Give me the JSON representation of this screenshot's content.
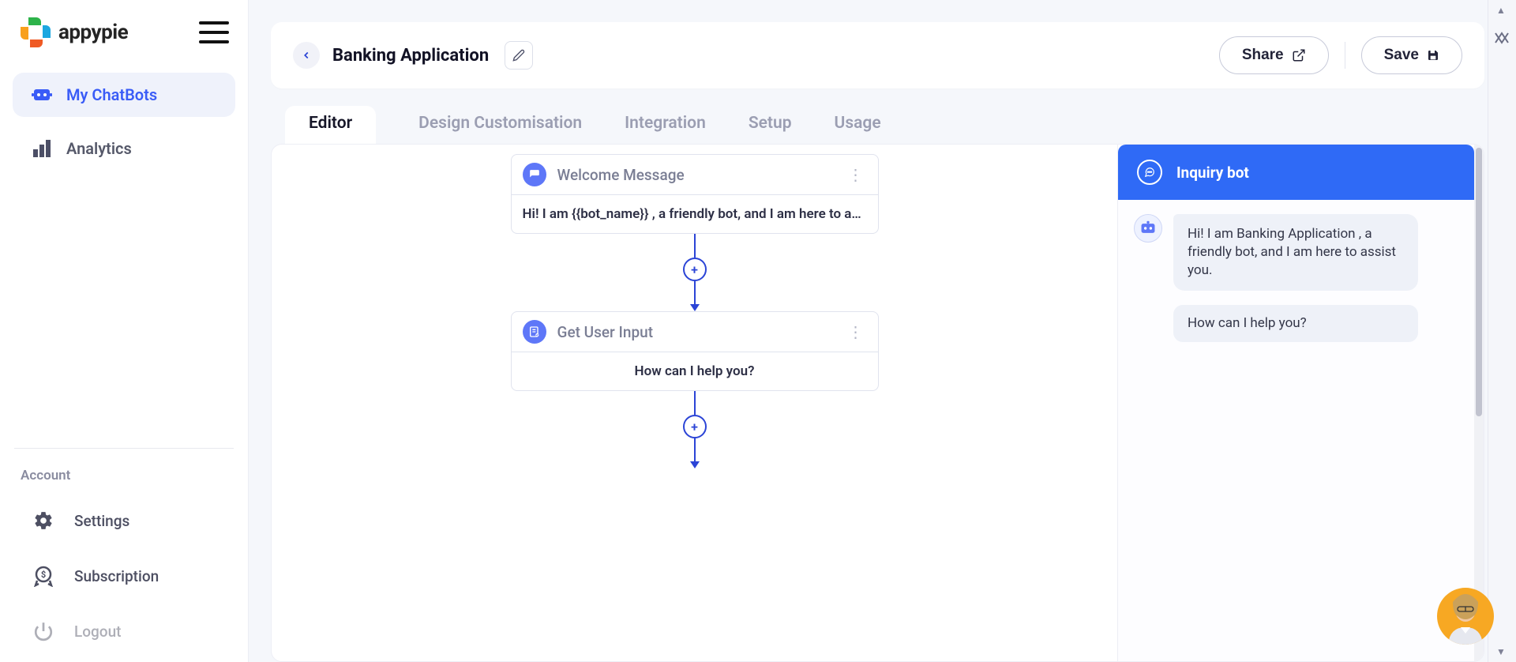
{
  "brand": {
    "name": "appypie"
  },
  "sidebar": {
    "nav": [
      {
        "label": "My ChatBots",
        "id": "my-chatbots",
        "active": true
      },
      {
        "label": "Analytics",
        "id": "analytics",
        "active": false
      }
    ],
    "account_label": "Account",
    "account_items": [
      {
        "label": "Settings",
        "id": "settings"
      },
      {
        "label": "Subscription",
        "id": "subscription"
      },
      {
        "label": "Logout",
        "id": "logout"
      }
    ]
  },
  "header": {
    "title": "Banking Application",
    "share_label": "Share",
    "save_label": "Save"
  },
  "tabs": [
    {
      "label": "Editor",
      "id": "editor",
      "active": true
    },
    {
      "label": "Design Customisation",
      "id": "design",
      "active": false
    },
    {
      "label": "Integration",
      "id": "integration",
      "active": false
    },
    {
      "label": "Setup",
      "id": "setup",
      "active": false
    },
    {
      "label": "Usage",
      "id": "usage",
      "active": false
    }
  ],
  "flow": {
    "nodes": [
      {
        "title": "Welcome Message",
        "body": "Hi! I am {{bot_name}} , a friendly bot, and I am here to a…",
        "icon": "comment-icon"
      },
      {
        "title": "Get User Input",
        "body": "How can I help you?",
        "icon": "form-icon",
        "center": true
      }
    ]
  },
  "preview": {
    "title": "Inquiry bot",
    "messages": [
      {
        "type": "bot",
        "text": "Hi! I am Banking Application  , a friendly bot, and I am here to assist you."
      },
      {
        "type": "bot_followup",
        "text": "How can I help you?"
      }
    ]
  },
  "colors": {
    "primary": "#2f6af6",
    "sidebar_active_bg": "#eff2fb",
    "sidebar_active_text": "#3a5cf7"
  }
}
